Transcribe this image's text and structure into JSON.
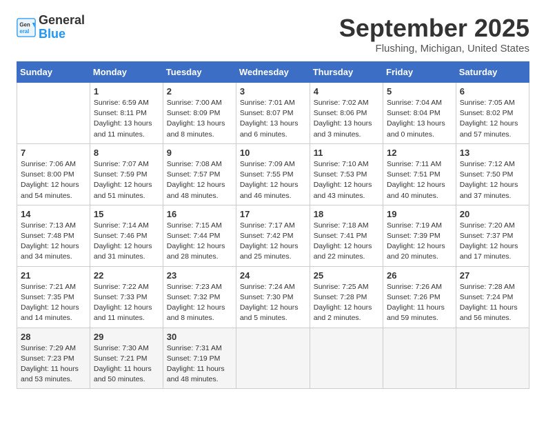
{
  "header": {
    "logo_general": "General",
    "logo_blue": "Blue",
    "month_title": "September 2025",
    "location": "Flushing, Michigan, United States"
  },
  "weekdays": [
    "Sunday",
    "Monday",
    "Tuesday",
    "Wednesday",
    "Thursday",
    "Friday",
    "Saturday"
  ],
  "weeks": [
    [
      {
        "day": "",
        "info": ""
      },
      {
        "day": "1",
        "info": "Sunrise: 6:59 AM\nSunset: 8:11 PM\nDaylight: 13 hours\nand 11 minutes."
      },
      {
        "day": "2",
        "info": "Sunrise: 7:00 AM\nSunset: 8:09 PM\nDaylight: 13 hours\nand 8 minutes."
      },
      {
        "day": "3",
        "info": "Sunrise: 7:01 AM\nSunset: 8:07 PM\nDaylight: 13 hours\nand 6 minutes."
      },
      {
        "day": "4",
        "info": "Sunrise: 7:02 AM\nSunset: 8:06 PM\nDaylight: 13 hours\nand 3 minutes."
      },
      {
        "day": "5",
        "info": "Sunrise: 7:04 AM\nSunset: 8:04 PM\nDaylight: 13 hours\nand 0 minutes."
      },
      {
        "day": "6",
        "info": "Sunrise: 7:05 AM\nSunset: 8:02 PM\nDaylight: 12 hours\nand 57 minutes."
      }
    ],
    [
      {
        "day": "7",
        "info": "Sunrise: 7:06 AM\nSunset: 8:00 PM\nDaylight: 12 hours\nand 54 minutes."
      },
      {
        "day": "8",
        "info": "Sunrise: 7:07 AM\nSunset: 7:59 PM\nDaylight: 12 hours\nand 51 minutes."
      },
      {
        "day": "9",
        "info": "Sunrise: 7:08 AM\nSunset: 7:57 PM\nDaylight: 12 hours\nand 48 minutes."
      },
      {
        "day": "10",
        "info": "Sunrise: 7:09 AM\nSunset: 7:55 PM\nDaylight: 12 hours\nand 46 minutes."
      },
      {
        "day": "11",
        "info": "Sunrise: 7:10 AM\nSunset: 7:53 PM\nDaylight: 12 hours\nand 43 minutes."
      },
      {
        "day": "12",
        "info": "Sunrise: 7:11 AM\nSunset: 7:51 PM\nDaylight: 12 hours\nand 40 minutes."
      },
      {
        "day": "13",
        "info": "Sunrise: 7:12 AM\nSunset: 7:50 PM\nDaylight: 12 hours\nand 37 minutes."
      }
    ],
    [
      {
        "day": "14",
        "info": "Sunrise: 7:13 AM\nSunset: 7:48 PM\nDaylight: 12 hours\nand 34 minutes."
      },
      {
        "day": "15",
        "info": "Sunrise: 7:14 AM\nSunset: 7:46 PM\nDaylight: 12 hours\nand 31 minutes."
      },
      {
        "day": "16",
        "info": "Sunrise: 7:15 AM\nSunset: 7:44 PM\nDaylight: 12 hours\nand 28 minutes."
      },
      {
        "day": "17",
        "info": "Sunrise: 7:17 AM\nSunset: 7:42 PM\nDaylight: 12 hours\nand 25 minutes."
      },
      {
        "day": "18",
        "info": "Sunrise: 7:18 AM\nSunset: 7:41 PM\nDaylight: 12 hours\nand 22 minutes."
      },
      {
        "day": "19",
        "info": "Sunrise: 7:19 AM\nSunset: 7:39 PM\nDaylight: 12 hours\nand 20 minutes."
      },
      {
        "day": "20",
        "info": "Sunrise: 7:20 AM\nSunset: 7:37 PM\nDaylight: 12 hours\nand 17 minutes."
      }
    ],
    [
      {
        "day": "21",
        "info": "Sunrise: 7:21 AM\nSunset: 7:35 PM\nDaylight: 12 hours\nand 14 minutes."
      },
      {
        "day": "22",
        "info": "Sunrise: 7:22 AM\nSunset: 7:33 PM\nDaylight: 12 hours\nand 11 minutes."
      },
      {
        "day": "23",
        "info": "Sunrise: 7:23 AM\nSunset: 7:32 PM\nDaylight: 12 hours\nand 8 minutes."
      },
      {
        "day": "24",
        "info": "Sunrise: 7:24 AM\nSunset: 7:30 PM\nDaylight: 12 hours\nand 5 minutes."
      },
      {
        "day": "25",
        "info": "Sunrise: 7:25 AM\nSunset: 7:28 PM\nDaylight: 12 hours\nand 2 minutes."
      },
      {
        "day": "26",
        "info": "Sunrise: 7:26 AM\nSunset: 7:26 PM\nDaylight: 11 hours\nand 59 minutes."
      },
      {
        "day": "27",
        "info": "Sunrise: 7:28 AM\nSunset: 7:24 PM\nDaylight: 11 hours\nand 56 minutes."
      }
    ],
    [
      {
        "day": "28",
        "info": "Sunrise: 7:29 AM\nSunset: 7:23 PM\nDaylight: 11 hours\nand 53 minutes."
      },
      {
        "day": "29",
        "info": "Sunrise: 7:30 AM\nSunset: 7:21 PM\nDaylight: 11 hours\nand 50 minutes."
      },
      {
        "day": "30",
        "info": "Sunrise: 7:31 AM\nSunset: 7:19 PM\nDaylight: 11 hours\nand 48 minutes."
      },
      {
        "day": "",
        "info": ""
      },
      {
        "day": "",
        "info": ""
      },
      {
        "day": "",
        "info": ""
      },
      {
        "day": "",
        "info": ""
      }
    ]
  ]
}
